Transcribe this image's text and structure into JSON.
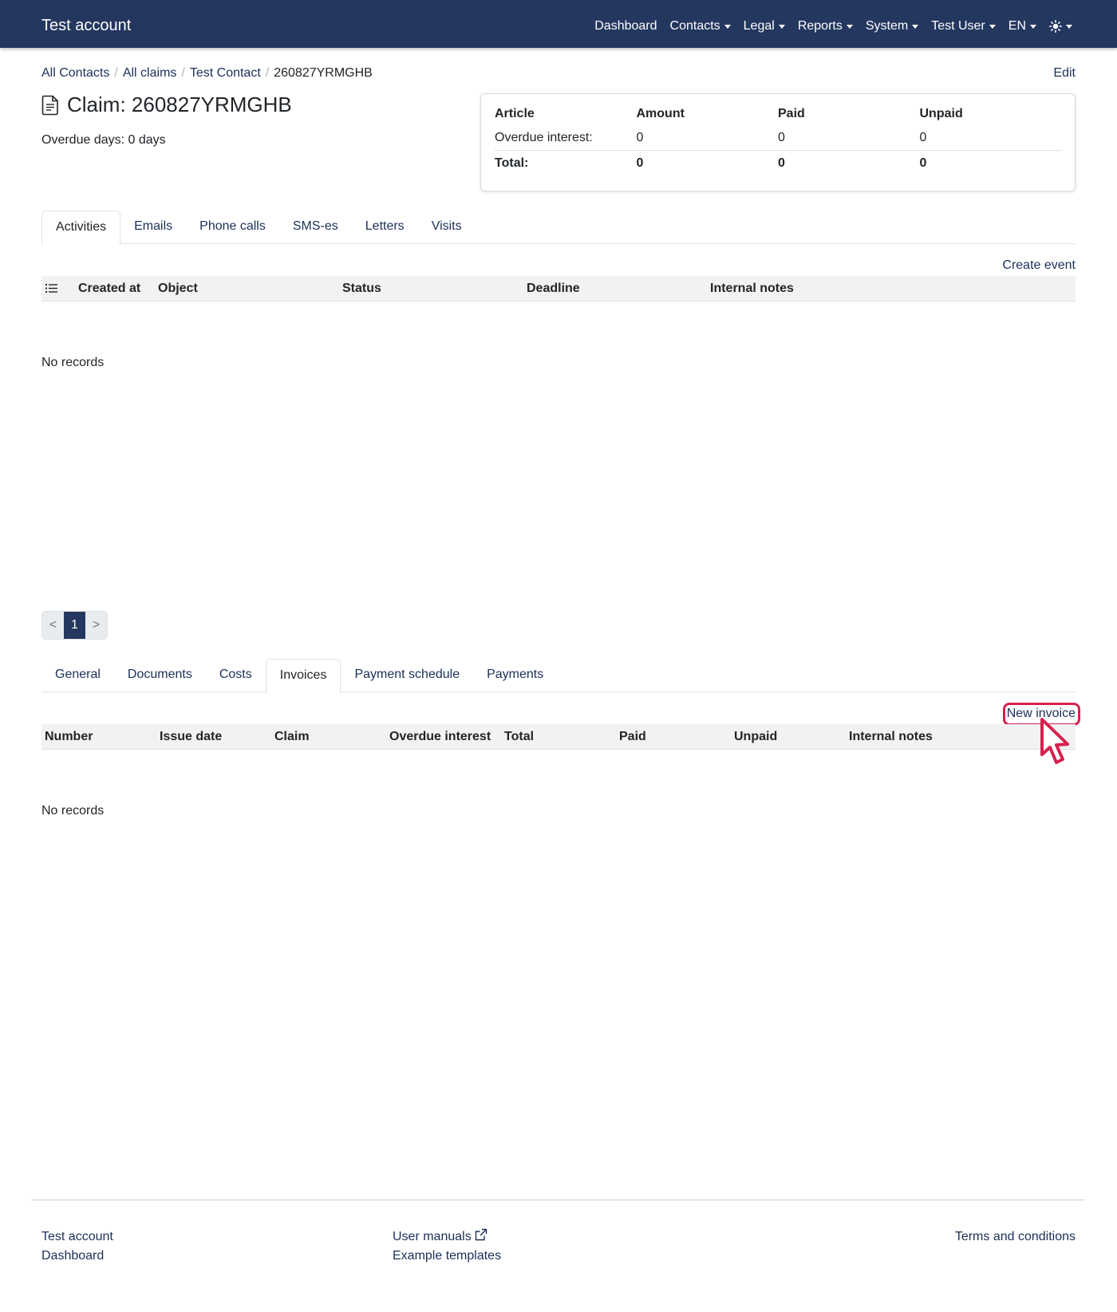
{
  "nav": {
    "brand": "Test account",
    "items": [
      "Dashboard",
      "Contacts",
      "Legal",
      "Reports",
      "System",
      "Test User",
      "EN"
    ],
    "theme_icon": "sun-icon"
  },
  "breadcrumb": {
    "items": [
      "All Contacts",
      "All claims",
      "Test Contact"
    ],
    "current": "260827YRMGHB",
    "edit": "Edit"
  },
  "claim": {
    "title": "Claim: 260827YRMGHB",
    "icon": "document-icon",
    "overdue": "Overdue days: 0 days"
  },
  "summary": {
    "headers": [
      "Article",
      "Amount",
      "Paid",
      "Unpaid"
    ],
    "row": [
      "Overdue interest:",
      "0",
      "0",
      "0"
    ],
    "total": [
      "Total:",
      "0",
      "0",
      "0"
    ]
  },
  "activities": {
    "tabs": [
      "Activities",
      "Emails",
      "Phone calls",
      "SMS-es",
      "Letters",
      "Visits"
    ],
    "create_event": "Create event",
    "columns": [
      "Created at",
      "Object",
      "Status",
      "Deadline",
      "Internal notes"
    ],
    "empty": "No records",
    "pager": [
      "<",
      "1",
      ">"
    ]
  },
  "invoices": {
    "tabs": [
      "General",
      "Documents",
      "Costs",
      "Invoices",
      "Payment schedule",
      "Payments"
    ],
    "new_invoice": "New invoice",
    "columns": [
      "Number",
      "Issue date",
      "Claim",
      "Overdue interest",
      "Total",
      "Paid",
      "Unpaid",
      "Internal notes"
    ],
    "empty": "No records"
  },
  "footer": {
    "col1": [
      "Test account",
      "Dashboard"
    ],
    "col2": [
      "User manuals",
      "Example templates"
    ],
    "col3": [
      "Terms and conditions"
    ]
  },
  "colors": {
    "navbar": "#24375f",
    "link": "#1c3058",
    "highlight": "#d7214e"
  }
}
